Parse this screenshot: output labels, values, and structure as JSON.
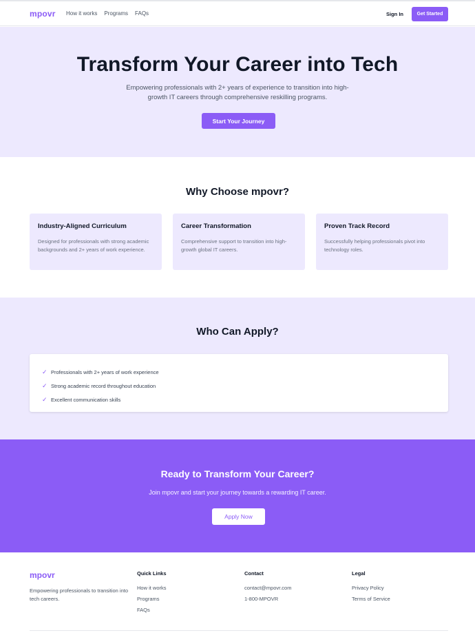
{
  "brand": {
    "name": "mpovr",
    "accent": "#8b5cf6",
    "tint": "#ede9fe"
  },
  "nav": {
    "links": [
      "How it works",
      "Programs",
      "FAQs"
    ],
    "sign_in": "Sign In",
    "get_started": "Get Started"
  },
  "hero": {
    "title": "Transform Your Career into Tech",
    "subtitle": "Empowering professionals with 2+ years of experience to transition into high-growth IT careers through comprehensive reskilling programs.",
    "cta": "Start Your Journey"
  },
  "why": {
    "title": "Why Choose mpovr?",
    "cards": [
      {
        "title": "Industry-Aligned Curriculum",
        "text": "Designed for professionals with strong academic backgrounds and 2+ years of work experience."
      },
      {
        "title": "Career Transformation",
        "text": "Comprehensive support to transition into high-growth global IT careers."
      },
      {
        "title": "Proven Track Record",
        "text": "Successfully helping professionals pivot into technology roles."
      }
    ]
  },
  "who": {
    "title": "Who Can Apply?",
    "check_icon": "check-icon",
    "requirements": [
      "Professionals with 2+ years of work experience",
      "Strong academic record throughout education",
      "Excellent communication skills"
    ]
  },
  "cta": {
    "title": "Ready to Transform Your Career?",
    "text": "Join mpovr and start your journey towards a rewarding IT career.",
    "button": "Apply Now"
  },
  "footer": {
    "brand": "mpovr",
    "tagline": "Empowering professionals to transition into tech careers.",
    "quick_links": {
      "title": "Quick Links",
      "items": [
        "How it works",
        "Programs",
        "FAQs"
      ]
    },
    "contact": {
      "title": "Contact",
      "items": [
        "contact@mpovr.com",
        "1-800-MPOVR"
      ]
    },
    "legal": {
      "title": "Legal",
      "items": [
        "Privacy Policy",
        "Terms of Service"
      ]
    }
  }
}
